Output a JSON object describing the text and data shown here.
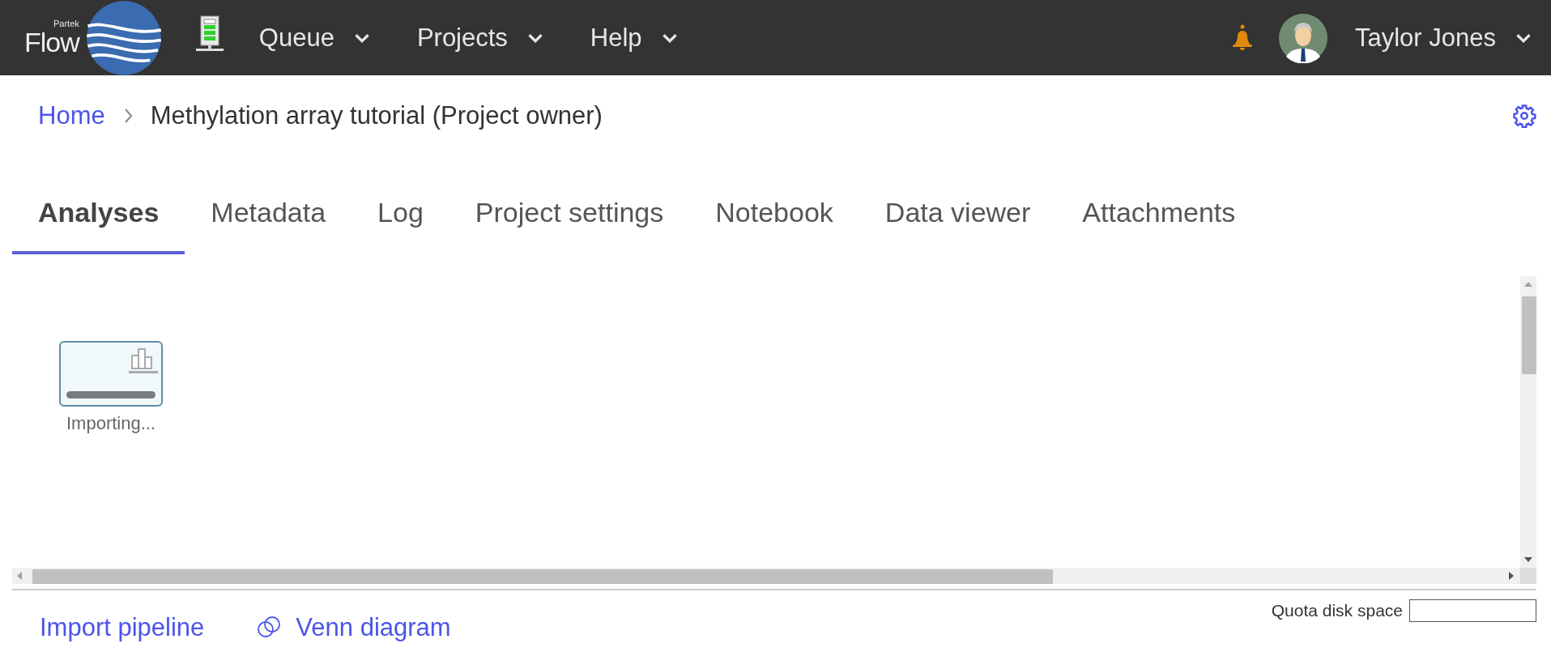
{
  "header": {
    "logo": {
      "small": "Partek",
      "large": "Flow"
    },
    "menus": [
      {
        "label": "Queue"
      },
      {
        "label": "Projects"
      },
      {
        "label": "Help"
      }
    ],
    "user": {
      "name": "Taylor Jones"
    }
  },
  "breadcrumb": [
    {
      "label": "Home",
      "kind": "link"
    },
    {
      "label": "Methylation array tutorial (Project owner)",
      "kind": "current"
    }
  ],
  "tabs": [
    {
      "label": "Analyses",
      "selected": true
    },
    {
      "label": "Metadata",
      "selected": false
    },
    {
      "label": "Log",
      "selected": false
    },
    {
      "label": "Project settings",
      "selected": false
    },
    {
      "label": "Notebook",
      "selected": false
    },
    {
      "label": "Data viewer",
      "selected": false
    },
    {
      "label": "Attachments",
      "selected": false
    }
  ],
  "analyses": [
    {
      "label": "Importing..."
    }
  ],
  "footer": {
    "links": [
      {
        "label": "Import pipeline",
        "kind": "plain"
      },
      {
        "label": "Venn diagram",
        "kind": "venn"
      }
    ],
    "quota": {
      "label": "Quota disk space"
    }
  }
}
